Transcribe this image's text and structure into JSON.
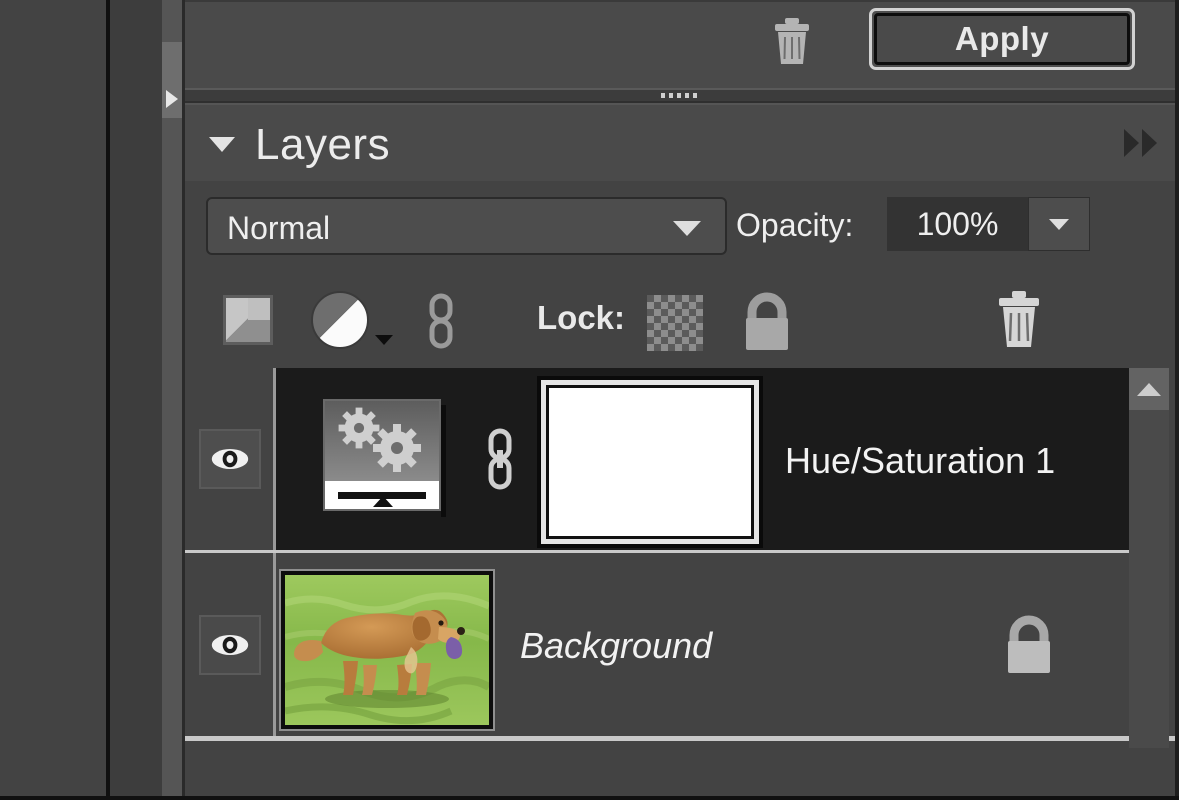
{
  "top_toolbar": {
    "delete_icon": "trash-icon",
    "apply_label": "Apply"
  },
  "panel": {
    "title": "Layers",
    "collapse_icon": "triangle-down-icon",
    "expand_icon": "double-chevron-right-icon",
    "grip_icon": "panel-grip-icon",
    "expand_arrow_icon": "triangle-right-icon"
  },
  "blend_row": {
    "blend_mode": "Normal",
    "blend_dropdown_icon": "chevron-down-icon",
    "opacity_label": "Opacity:",
    "opacity_value": "100%",
    "opacity_stepper_icon": "chevron-down-icon"
  },
  "lock_toolbar": {
    "new_layer_icon": "new-layer-icon",
    "adjustment_layer_icon": "adjustment-layer-icon",
    "adjustment_dropdown_icon": "triangle-down-icon",
    "link_layers_icon": "chain-link-icon",
    "lock_label": "Lock:",
    "lock_transparency_icon": "checkerboard-icon",
    "lock_all_icon": "padlock-icon",
    "delete_layer_icon": "trash-icon"
  },
  "layers": [
    {
      "name": "Hue/Saturation 1",
      "selected": true,
      "visible": true,
      "visibility_icon": "eye-icon",
      "thumbnail_icon": "adjustment-gears-thumbnail",
      "link_icon": "chain-link-icon",
      "mask_icon": "layer-mask-thumbnail-white",
      "italic": false,
      "locked": false
    },
    {
      "name": "Background",
      "selected": false,
      "visible": true,
      "visibility_icon": "eye-icon",
      "thumbnail_icon": "photo-thumbnail-dog-on-grass",
      "italic": true,
      "locked": true,
      "lock_icon": "padlock-icon"
    }
  ],
  "scrollbar": {
    "up_arrow_icon": "scroll-up-arrow-icon"
  },
  "colors": {
    "panel_bg": "#434343",
    "selected_row_bg": "#1b1b1b",
    "text": "#f2f2f2",
    "border_light": "#c9c9c9"
  }
}
